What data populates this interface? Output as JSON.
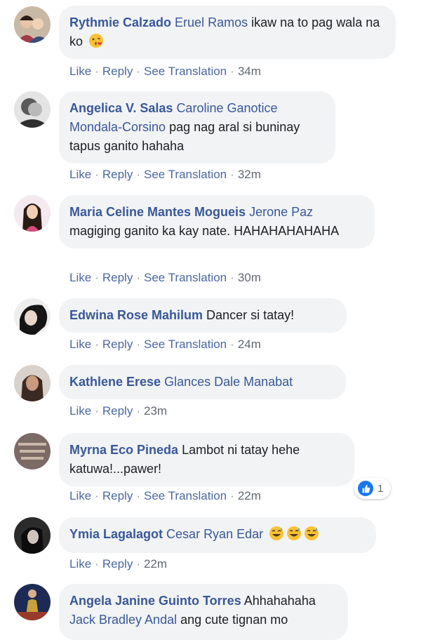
{
  "actions": {
    "like": "Like",
    "reply": "Reply",
    "see_translation": "See Translation",
    "dot": "·"
  },
  "comments": [
    {
      "author": "Rythmie Calzado",
      "tag": "Eruel Ramos",
      "text": "ikaw na to pag wala na ko",
      "emoji": "kissing-face-emoji",
      "time": "34m"
    },
    {
      "author": "Angelica V. Salas",
      "tag": "Caroline Ganotice Mondala-Corsino",
      "text": "pag nag aral si buninay tapus ganito hahaha",
      "time": "32m"
    },
    {
      "author": "Maria Celine Mantes Mogueis",
      "tag": "Jerone Paz",
      "text": "magiging ganito ka kay nate. HAHAHAHAHAHA",
      "time": "30m"
    },
    {
      "author": "Edwina Rose Mahilum",
      "tag": "",
      "text": "Dancer si tatay!",
      "time": "24m"
    },
    {
      "author": "Kathlene Erese",
      "tag": "Glances Dale Manabat",
      "text": "",
      "time": "23m"
    },
    {
      "author": "Myrna Eco Pineda",
      "tag": "",
      "text": "Lambot ni tatay hehe katuwa!...pawer!",
      "time": "22m",
      "reaction_count": "1"
    },
    {
      "author": "Ymia Lagalagot",
      "tag": "Cesar Ryan Edar",
      "text": "",
      "emoji": "sweat-smile-emoji x3",
      "time": "22m"
    },
    {
      "author": "Angela Janine Guinto Torres",
      "tag": "Jack Bradley Andal",
      "text_before_tag": "Ahhahahaha",
      "text": "ang cute tignan mo"
    }
  ],
  "colors": {
    "author": "#385898",
    "bubble": "#f2f3f5",
    "meta": "#616770",
    "reaction": "#1877f2"
  }
}
